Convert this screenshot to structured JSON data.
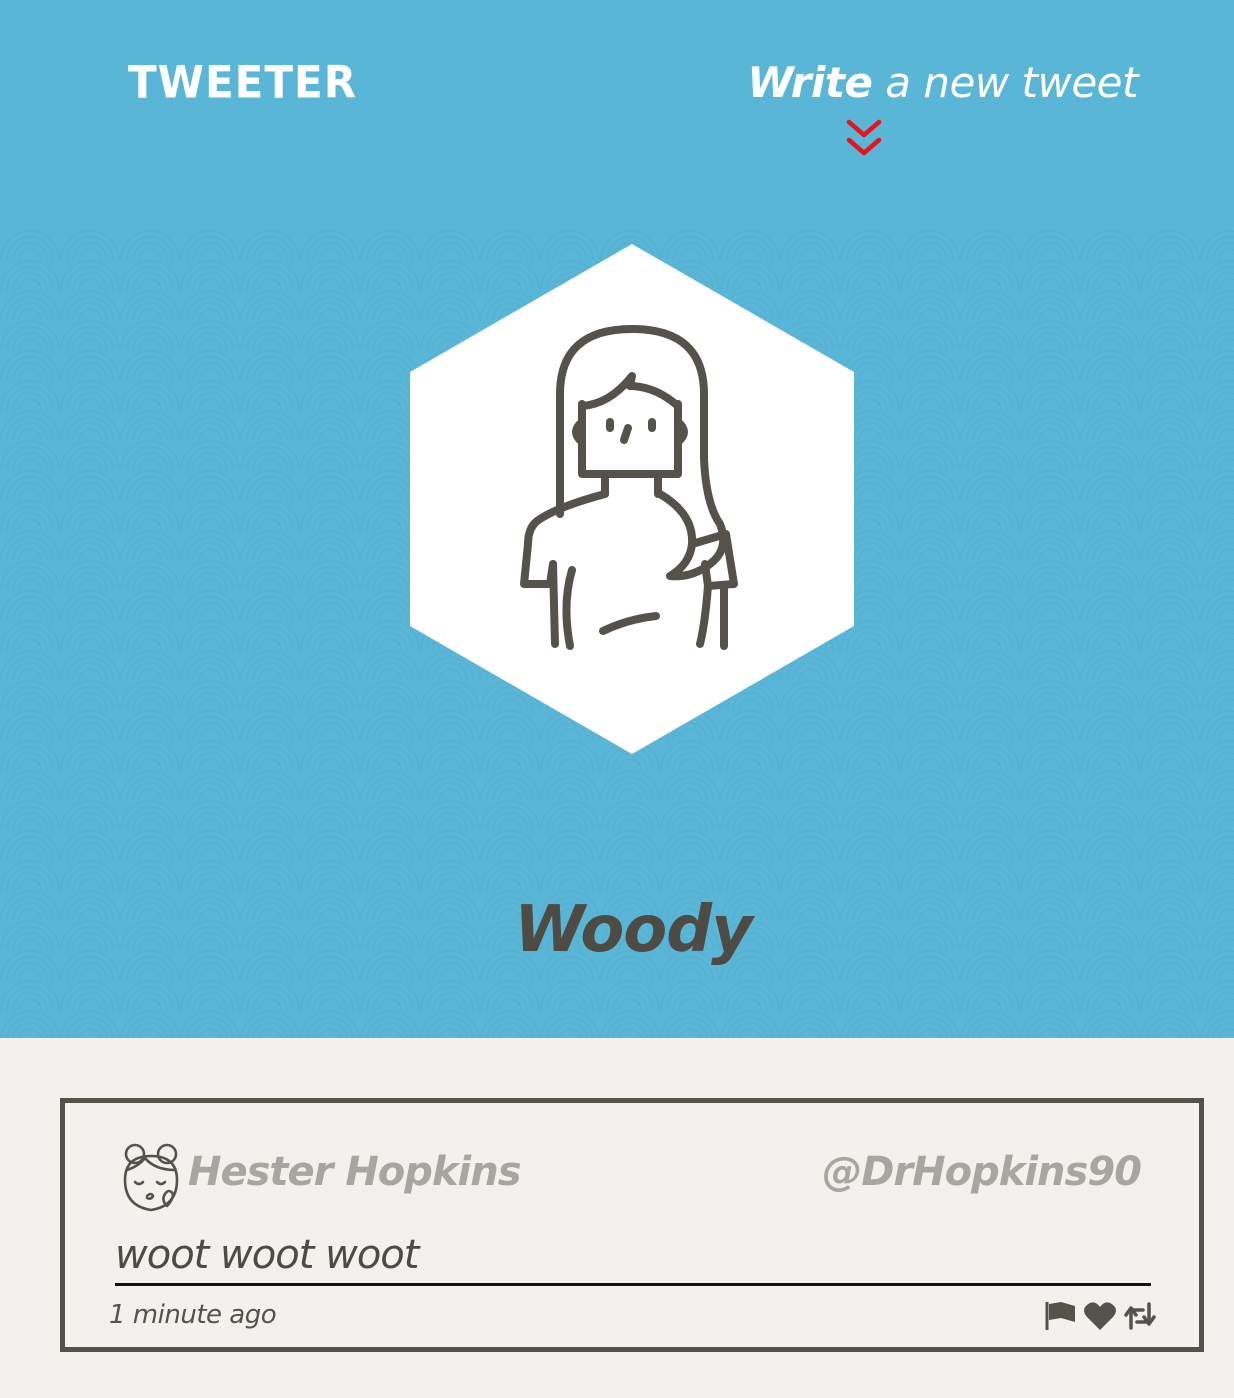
{
  "header": {
    "brand": "TWEETER",
    "compose_bold": "Write",
    "compose_rest": " a new tweet",
    "compose_icon": "double-chevron-down-icon",
    "background_color": "#5ab6d6",
    "accent_color": "#e8141b"
  },
  "profile": {
    "avatar_icon": "woman-avatar-icon",
    "name": "Woody"
  },
  "tweets": [
    {
      "avatar_icon": "girl-kiss-avatar-icon",
      "author": "Hester Hopkins",
      "handle": "@DrHopkins90",
      "body": "woot woot woot",
      "time": "1 minute ago",
      "actions": [
        "flag-icon",
        "heart-icon",
        "retweet-icon"
      ]
    }
  ]
}
